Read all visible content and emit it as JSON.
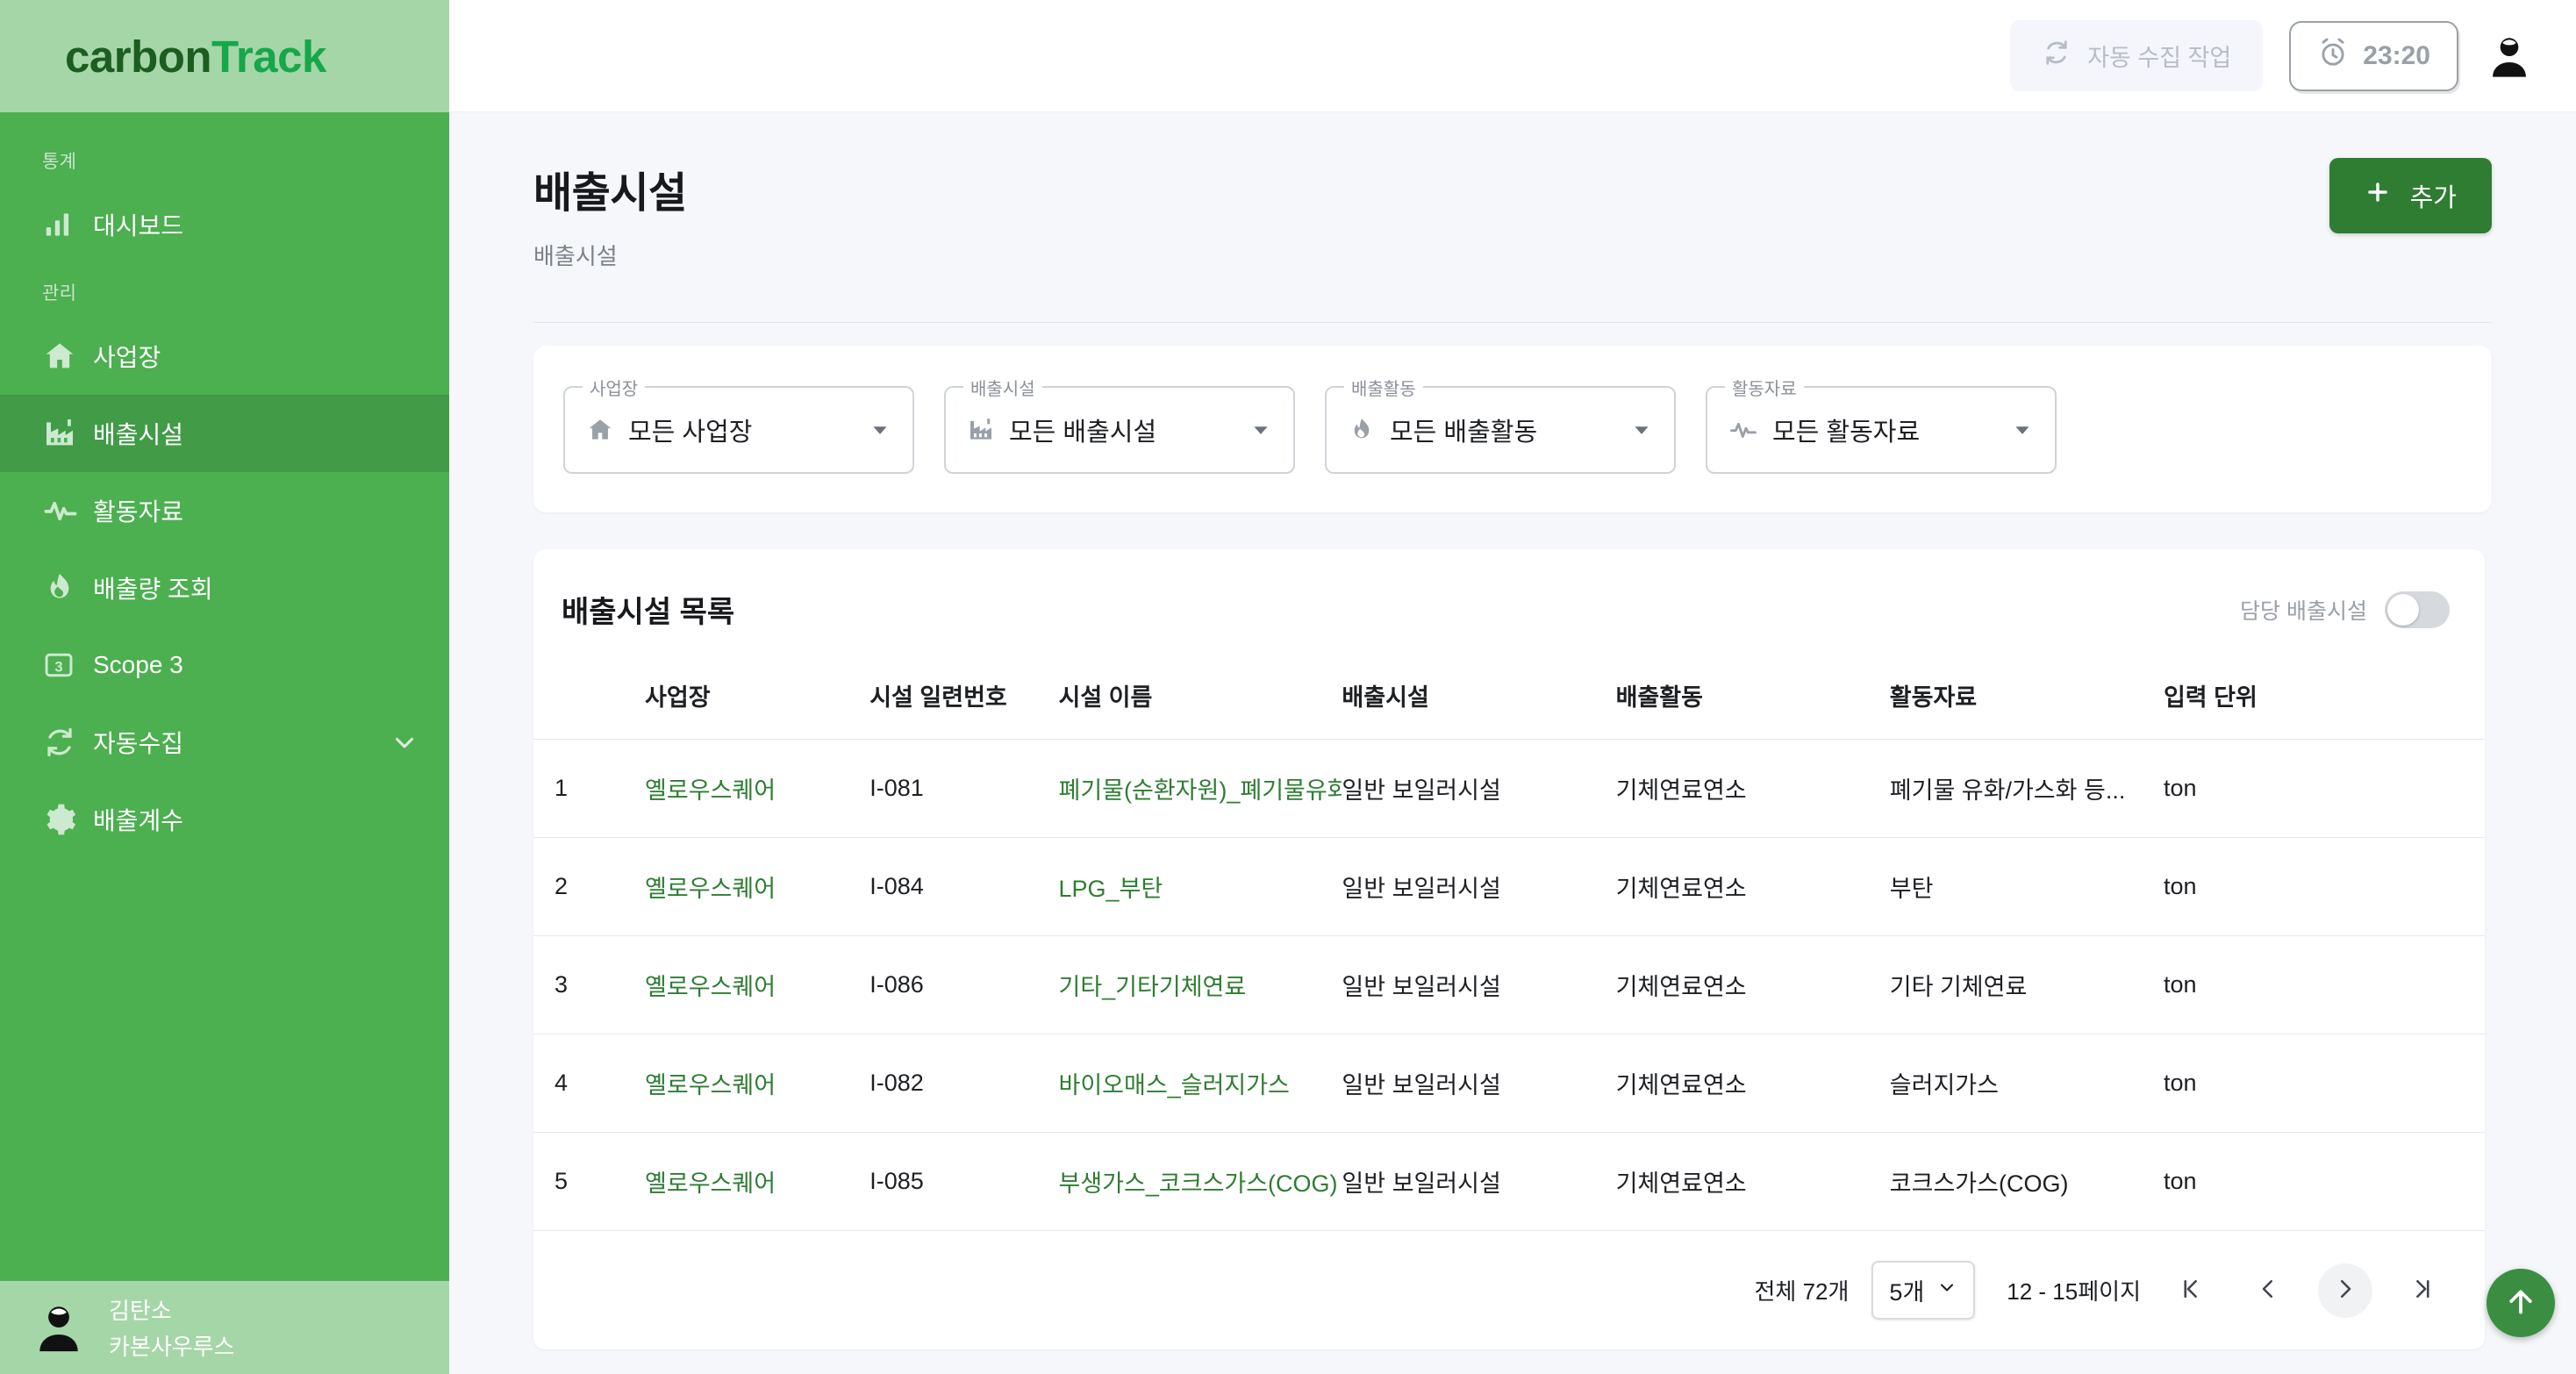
{
  "brand": {
    "part1": "carbon",
    "part2": "Track"
  },
  "sidebar": {
    "sections": [
      {
        "label": "통계"
      },
      {
        "label": "관리"
      }
    ],
    "items": [
      {
        "label": "대시보드",
        "icon": "bar-chart-icon",
        "section": 0,
        "active": false,
        "chevron": false
      },
      {
        "label": "사업장",
        "icon": "home-icon",
        "section": 1,
        "active": false,
        "chevron": false
      },
      {
        "label": "배출시설",
        "icon": "factory-icon",
        "section": 1,
        "active": true,
        "chevron": false
      },
      {
        "label": "활동자료",
        "icon": "activity-icon",
        "section": 1,
        "active": false,
        "chevron": false
      },
      {
        "label": "배출량 조회",
        "icon": "flame-icon",
        "section": 1,
        "active": false,
        "chevron": false
      },
      {
        "label": "Scope 3",
        "icon": "scope3-icon",
        "section": 1,
        "active": false,
        "chevron": false
      },
      {
        "label": "자동수집",
        "icon": "sync-icon",
        "section": 1,
        "active": false,
        "chevron": true
      },
      {
        "label": "배출계수",
        "icon": "gear-icon",
        "section": 1,
        "active": false,
        "chevron": false
      }
    ],
    "user": {
      "name": "김탄소",
      "org": "카본사우루스",
      "avatar_icon": "user-avatar-icon"
    }
  },
  "topbar": {
    "auto_job_label": "자동 수집 작업",
    "auto_job_icon": "sync-icon",
    "timer_value": "23:20",
    "timer_icon": "alarm-clock-icon",
    "avatar_icon": "user-avatar-icon"
  },
  "page": {
    "title": "배출시설",
    "subtitle": "배출시설",
    "add_label": "추가",
    "add_icon": "plus-icon"
  },
  "filters": [
    {
      "legend": "사업장",
      "value": "모든 사업장",
      "icon": "home-icon"
    },
    {
      "legend": "배출시설",
      "value": "모든 배출시설",
      "icon": "factory-icon"
    },
    {
      "legend": "배출활동",
      "value": "모든 배출활동",
      "icon": "flame-icon"
    },
    {
      "legend": "활동자료",
      "value": "모든 활동자료",
      "icon": "activity-icon"
    }
  ],
  "list": {
    "title": "배출시설 목록",
    "toggle_label": "담당 배출시설",
    "toggle_on": false,
    "columns": [
      "",
      "사업장",
      "시설 일련번호",
      "시설 이름",
      "배출시설",
      "배출활동",
      "활동자료",
      "입력 단위",
      ""
    ],
    "rows": [
      {
        "index": "1",
        "site": "옐로우스퀘어",
        "serial": "I-081",
        "name": "폐기물(순환자원)_폐기물유화/가",
        "facility": "일반 보일러시설",
        "activity": "기체연료연소",
        "data": "폐기물 유화/가스화 등...",
        "unit": "ton"
      },
      {
        "index": "2",
        "site": "옐로우스퀘어",
        "serial": "I-084",
        "name": "LPG_부탄",
        "facility": "일반 보일러시설",
        "activity": "기체연료연소",
        "data": "부탄",
        "unit": "ton"
      },
      {
        "index": "3",
        "site": "옐로우스퀘어",
        "serial": "I-086",
        "name": "기타_기타기체연료",
        "facility": "일반 보일러시설",
        "activity": "기체연료연소",
        "data": "기타 기체연료",
        "unit": "ton"
      },
      {
        "index": "4",
        "site": "옐로우스퀘어",
        "serial": "I-082",
        "name": "바이오매스_슬러지가스",
        "facility": "일반 보일러시설",
        "activity": "기체연료연소",
        "data": "슬러지가스",
        "unit": "ton"
      },
      {
        "index": "5",
        "site": "옐로우스퀘어",
        "serial": "I-085",
        "name": "부생가스_코크스가스(COG)",
        "facility": "일반 보일러시설",
        "activity": "기체연료연소",
        "data": "코크스가스(COG)",
        "unit": "ton"
      }
    ],
    "footer": {
      "total_text": "전체 72개",
      "page_size": "5개",
      "range_text": "12 - 15페이지",
      "first_icon": "first-page-icon",
      "prev_icon": "chevron-left-icon",
      "next_icon": "chevron-right-icon",
      "last_icon": "last-page-icon"
    }
  },
  "fab": {
    "icon": "arrow-up-icon"
  },
  "colors": {
    "sidebar": "#4caf50",
    "sidebar_active": "#419b47",
    "brand_bar": "#a5d6a7",
    "brand_dark": "#1b5e20",
    "brand_light": "#15a74a",
    "accent": "#2e7d32",
    "link": "#2e7d32",
    "page_bg": "#f6f7fb"
  }
}
